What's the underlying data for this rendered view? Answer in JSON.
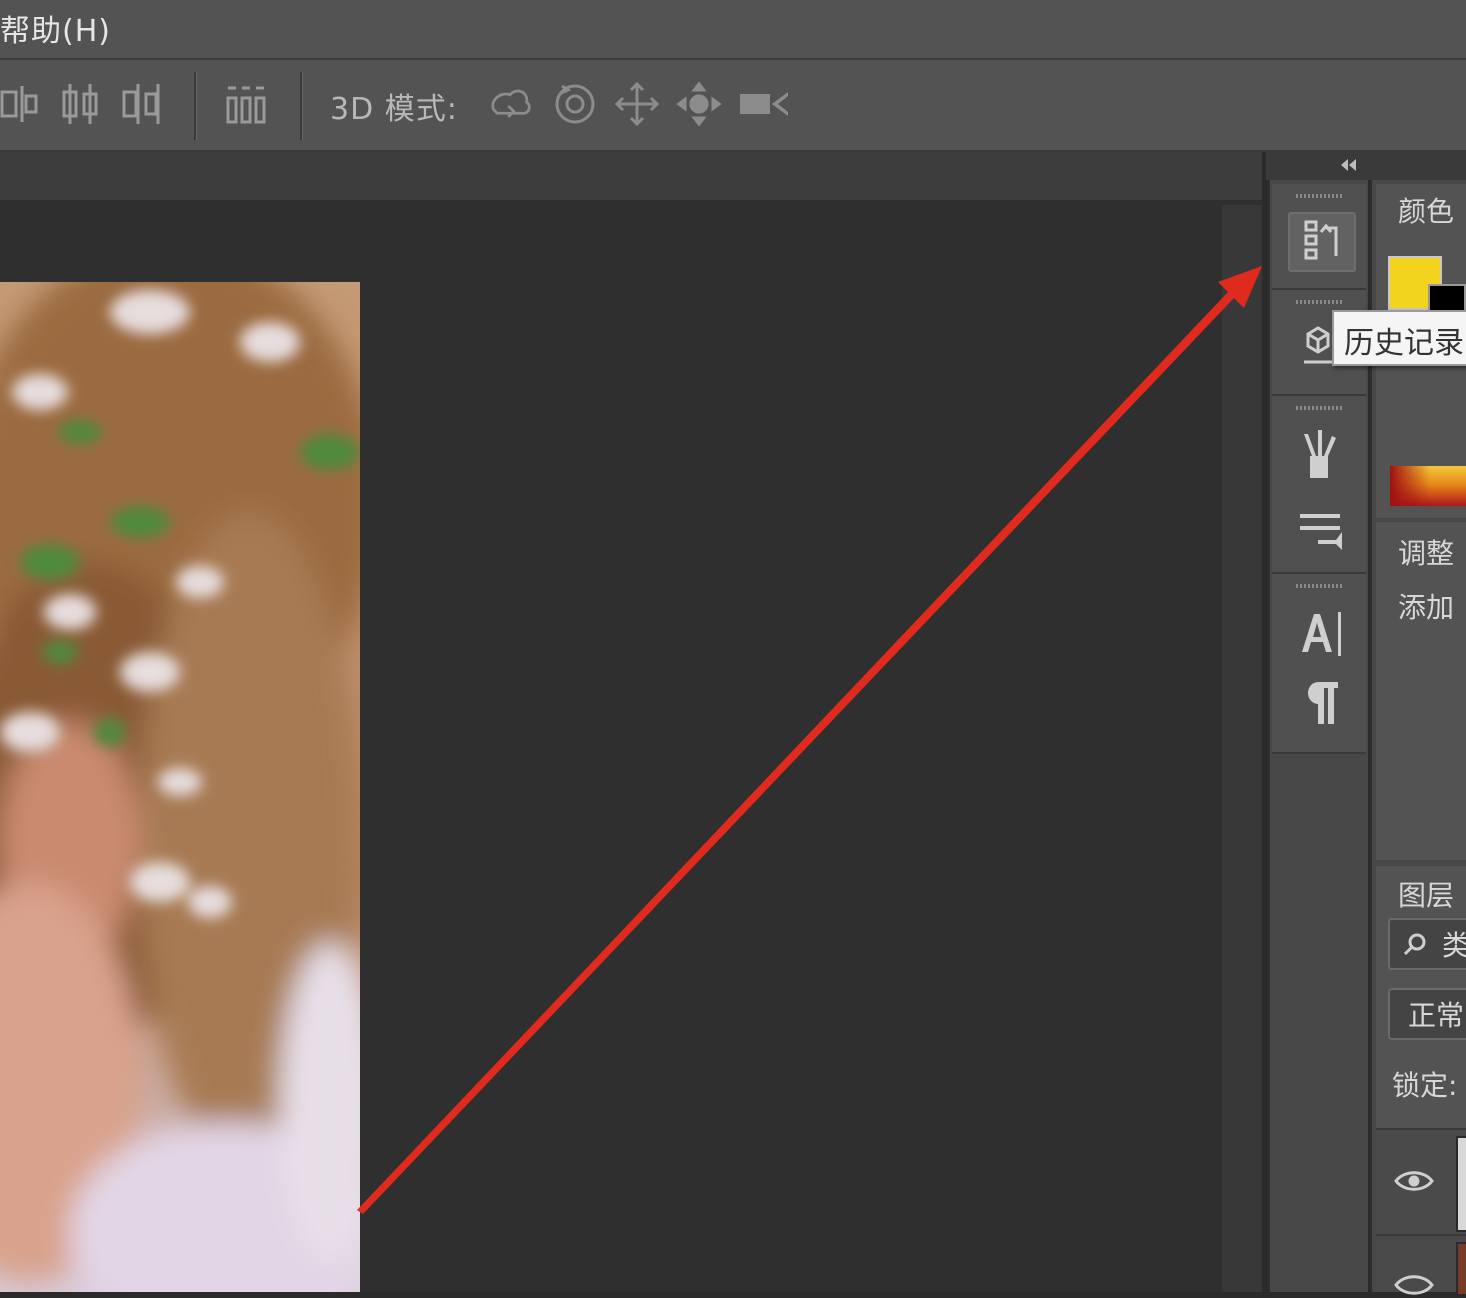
{
  "menu": {
    "help": "帮助(H)"
  },
  "options_bar": {
    "mode_label": "3D 模式:",
    "icons": [
      "align-right-edges-icon",
      "distribute-horizontal-centers-icon",
      "distribute-right-edges-icon",
      "auto-align-layers-icon",
      "3d-rotate-icon",
      "3d-roll-icon",
      "3d-pan-icon",
      "3d-slide-icon",
      "3d-scale-icon"
    ]
  },
  "dock": {
    "tooltip": "历史记录",
    "strip_icons": [
      "history-icon",
      "3d-cube-icon",
      "brush-icon",
      "brush-preset-icon",
      "character-icon",
      "paragraph-icon"
    ]
  },
  "panels": {
    "color": {
      "title": "颜色",
      "foreground": "#f2d41e",
      "background": "#000000"
    },
    "adjustments": {
      "title": "调整",
      "hint": "添加"
    },
    "layers": {
      "title": "图层",
      "filter_kind": "类",
      "blend_mode": "正常",
      "lock_label": "锁定:"
    }
  },
  "annotation": {
    "color": "#e02a1e"
  }
}
